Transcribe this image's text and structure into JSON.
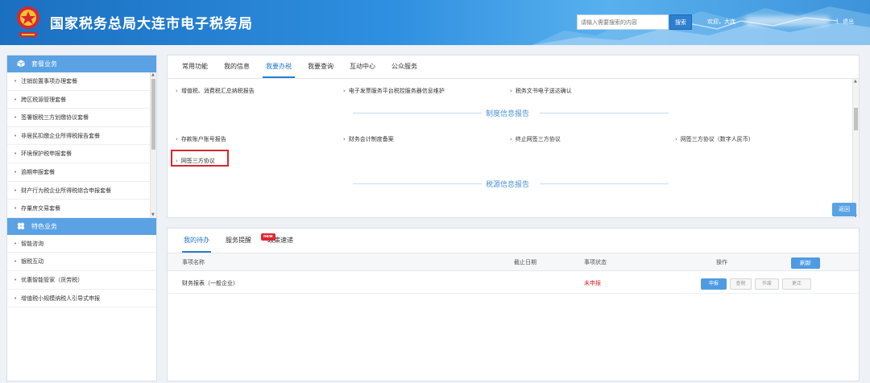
{
  "header": {
    "title": "国家税务总局大连市电子税务局",
    "logo_icon": "tax-bureau-emblem-icon",
    "search_placeholder": "请输入需要搜索的内容",
    "search_label": "搜索",
    "welcome": "欢迎，大连",
    "separator": "|",
    "logout": "退出"
  },
  "sidebar": {
    "section1": {
      "title": "套餐业务",
      "icon": "package-icon"
    },
    "items1": [
      "注销前置事项办理套餐",
      "跨区税源管理套餐",
      "签署银税三方划缴协议套餐",
      "非居民扣缴企业所得税报告套餐",
      "环境保护税申报套餐",
      "逾期申报套餐",
      "财产行为税企业所得税综合申报套餐",
      "存量房交易套餐"
    ],
    "section2": {
      "title": "特色业务",
      "icon": "star-cluster-icon"
    },
    "items2": [
      "智能咨询",
      "银税互动",
      "优惠智能管家（货劳税）",
      "增值税小规模纳税人引导式申报"
    ]
  },
  "main": {
    "tabs": [
      "常用功能",
      "我的信息",
      "我要办税",
      "我要查询",
      "互动中心",
      "公众服务"
    ],
    "active_tab": 2,
    "row1": [
      "增值税、消费税汇总纳税报告",
      "电子发票服务平台税控服务器信息维护",
      "税务文书电子送达确认"
    ],
    "section_a": "制度信息报告",
    "row2": [
      "存款账户账号报告",
      "财务会计制度备案",
      "终止网签三方协议",
      "网签三方协议（数字人民币）"
    ],
    "row3": [
      "网签三方协议"
    ],
    "section_b": "税源信息报告",
    "back_label": "返回"
  },
  "bottom": {
    "tabs": [
      "我的待办",
      "服务提醒",
      "政策速递"
    ],
    "new_badge": "new",
    "columns": [
      "事项名称",
      "截止日期",
      "事项状态",
      "操作"
    ],
    "refresh_label": "刷新",
    "rows": [
      {
        "name": "财务报表（一般企业）",
        "deadline": "",
        "status": "未申报",
        "actions": [
          "申报",
          "查税",
          "作废",
          "更正"
        ]
      }
    ]
  },
  "colors": {
    "header_blue": "#1b6fc0",
    "accent_blue": "#2b7bd1",
    "sidebar_head": "#5aa2e4",
    "status_red": "#e0262d",
    "highlight_red": "#d9272e"
  }
}
